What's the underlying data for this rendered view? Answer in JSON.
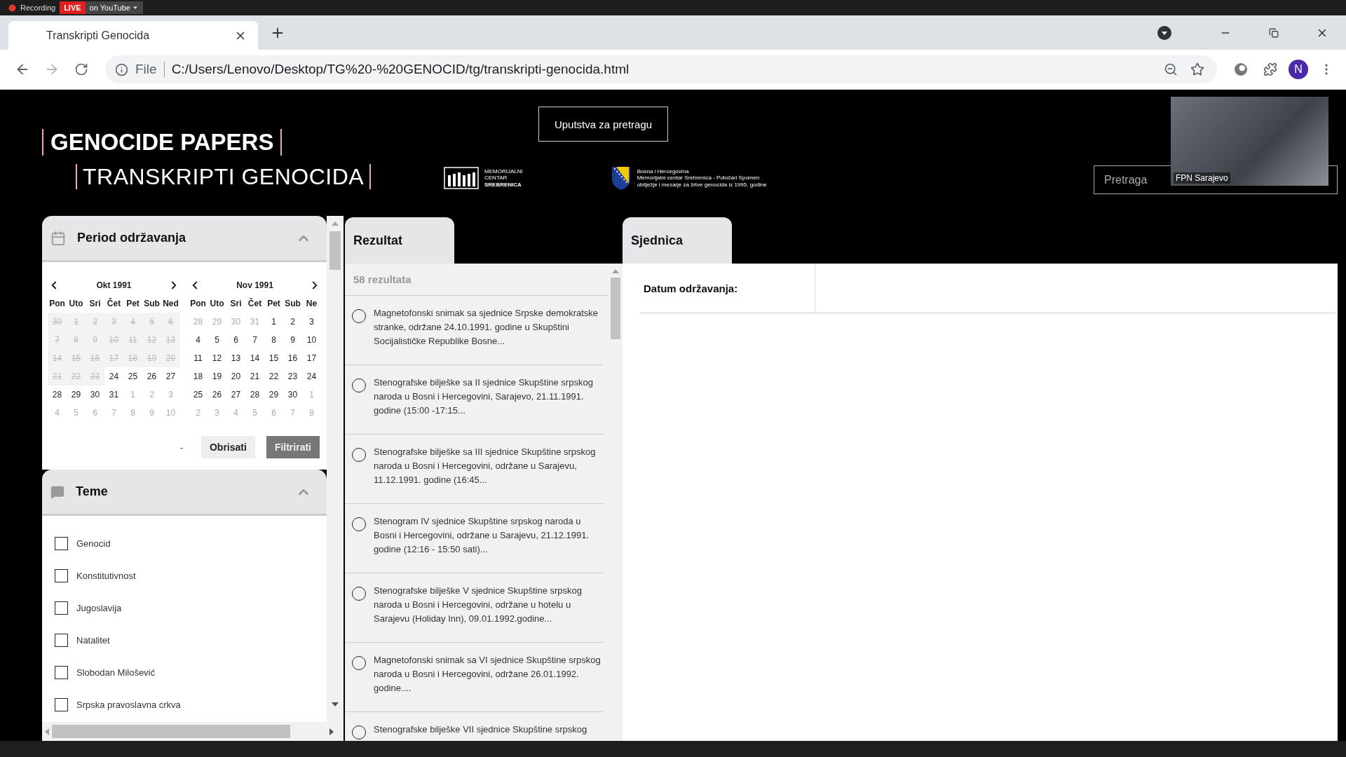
{
  "recording_bar": {
    "status": "Recording",
    "live_badge": "LIVE",
    "platform": "on YouTube"
  },
  "browser": {
    "tab": {
      "title": "Transkripti Genocida",
      "selected": true
    },
    "forward_disabled": true,
    "address": {
      "scheme": "File",
      "url": "C:/Users/Lenovo/Desktop/TG%20-%20GENOCID/tg/transkripti-genocida.html"
    },
    "profile_initial": "N"
  },
  "header": {
    "title": "GENOCIDE PAPERS",
    "subtitle": "TRANSKRIPTI GENOCIDA",
    "help_button": "Uputstva za pretragu",
    "memorial_logo": [
      "MEMORIJALNI",
      "CENTAR",
      "SREBRENICA"
    ],
    "partner_logo": [
      "Bosna i Hercegovina",
      "Memorijalni centar Srebrenica - Potočari Spomen",
      "obilježje i mezarje za žrtve genocida iz 1995. godine"
    ],
    "search": {
      "placeholder": "Pretraga"
    },
    "video": {
      "name": "FPN Sarajevo"
    }
  },
  "filters": {
    "period": {
      "title": "Period održavanja",
      "expanded": true,
      "months": [
        {
          "label": "Okt 1991",
          "weekdays": [
            "Pon",
            "Uto",
            "Sri",
            "Čet",
            "Pet",
            "Sub",
            "Ned"
          ],
          "days": [
            {
              "d": "30",
              "kind": "disabled"
            },
            {
              "d": "1",
              "kind": "disabled"
            },
            {
              "d": "2",
              "kind": "disabled"
            },
            {
              "d": "3",
              "kind": "disabled"
            },
            {
              "d": "4",
              "kind": "disabled"
            },
            {
              "d": "5",
              "kind": "disabled"
            },
            {
              "d": "6",
              "kind": "disabled"
            },
            {
              "d": "7",
              "kind": "disabled"
            },
            {
              "d": "8",
              "kind": "disabled"
            },
            {
              "d": "9",
              "kind": "disabled"
            },
            {
              "d": "10",
              "kind": "disabled"
            },
            {
              "d": "11",
              "kind": "disabled"
            },
            {
              "d": "12",
              "kind": "disabled"
            },
            {
              "d": "13",
              "kind": "disabled"
            },
            {
              "d": "14",
              "kind": "disabled"
            },
            {
              "d": "15",
              "kind": "disabled"
            },
            {
              "d": "16",
              "kind": "disabled"
            },
            {
              "d": "17",
              "kind": "disabled"
            },
            {
              "d": "18",
              "kind": "disabled"
            },
            {
              "d": "19",
              "kind": "disabled"
            },
            {
              "d": "20",
              "kind": "disabled"
            },
            {
              "d": "21",
              "kind": "disabled"
            },
            {
              "d": "22",
              "kind": "disabled"
            },
            {
              "d": "23",
              "kind": "disabled"
            },
            {
              "d": "24",
              "kind": "current"
            },
            {
              "d": "25",
              "kind": "current"
            },
            {
              "d": "26",
              "kind": "current"
            },
            {
              "d": "27",
              "kind": "current"
            },
            {
              "d": "28",
              "kind": "current"
            },
            {
              "d": "29",
              "kind": "current"
            },
            {
              "d": "30",
              "kind": "current"
            },
            {
              "d": "31",
              "kind": "current"
            },
            {
              "d": "1",
              "kind": "other"
            },
            {
              "d": "2",
              "kind": "other"
            },
            {
              "d": "3",
              "kind": "other"
            },
            {
              "d": "4",
              "kind": "other"
            },
            {
              "d": "5",
              "kind": "other"
            },
            {
              "d": "6",
              "kind": "other"
            },
            {
              "d": "7",
              "kind": "other"
            },
            {
              "d": "8",
              "kind": "other"
            },
            {
              "d": "9",
              "kind": "other"
            },
            {
              "d": "10",
              "kind": "other"
            }
          ]
        },
        {
          "label": "Nov 1991",
          "weekdays": [
            "Pon",
            "Uto",
            "Sri",
            "Čet",
            "Pet",
            "Sub",
            "Ne"
          ],
          "days": [
            {
              "d": "28",
              "kind": "other"
            },
            {
              "d": "29",
              "kind": "other"
            },
            {
              "d": "30",
              "kind": "other"
            },
            {
              "d": "31",
              "kind": "other"
            },
            {
              "d": "1",
              "kind": "current"
            },
            {
              "d": "2",
              "kind": "current"
            },
            {
              "d": "3",
              "kind": "current"
            },
            {
              "d": "4",
              "kind": "current"
            },
            {
              "d": "5",
              "kind": "current"
            },
            {
              "d": "6",
              "kind": "current"
            },
            {
              "d": "7",
              "kind": "current"
            },
            {
              "d": "8",
              "kind": "current"
            },
            {
              "d": "9",
              "kind": "current"
            },
            {
              "d": "10",
              "kind": "current"
            },
            {
              "d": "11",
              "kind": "current"
            },
            {
              "d": "12",
              "kind": "current"
            },
            {
              "d": "13",
              "kind": "current"
            },
            {
              "d": "14",
              "kind": "current"
            },
            {
              "d": "15",
              "kind": "current"
            },
            {
              "d": "16",
              "kind": "current"
            },
            {
              "d": "17",
              "kind": "current"
            },
            {
              "d": "18",
              "kind": "current"
            },
            {
              "d": "19",
              "kind": "current"
            },
            {
              "d": "20",
              "kind": "current"
            },
            {
              "d": "21",
              "kind": "current"
            },
            {
              "d": "22",
              "kind": "current"
            },
            {
              "d": "23",
              "kind": "current"
            },
            {
              "d": "24",
              "kind": "current"
            },
            {
              "d": "25",
              "kind": "current"
            },
            {
              "d": "26",
              "kind": "current"
            },
            {
              "d": "27",
              "kind": "current"
            },
            {
              "d": "28",
              "kind": "current"
            },
            {
              "d": "29",
              "kind": "current"
            },
            {
              "d": "30",
              "kind": "current"
            },
            {
              "d": "1",
              "kind": "other"
            },
            {
              "d": "2",
              "kind": "other"
            },
            {
              "d": "3",
              "kind": "other"
            },
            {
              "d": "4",
              "kind": "other"
            },
            {
              "d": "5",
              "kind": "other"
            },
            {
              "d": "6",
              "kind": "other"
            },
            {
              "d": "7",
              "kind": "other"
            },
            {
              "d": "8",
              "kind": "other"
            }
          ]
        }
      ],
      "separator": "-",
      "buttons": [
        "Obrisati",
        "Filtrirati"
      ]
    },
    "topics": {
      "title": "Teme",
      "expanded": true,
      "items": [
        {
          "label": "Genocid",
          "checked": false
        },
        {
          "label": "Konstitutivnost",
          "checked": false
        },
        {
          "label": "Jugoslavija",
          "checked": false
        },
        {
          "label": "Natalitet",
          "checked": false
        },
        {
          "label": "Slobodan Milošević",
          "checked": false
        },
        {
          "label": "Srpska pravoslavna crkva",
          "checked": false
        }
      ]
    }
  },
  "results": {
    "tab": "Rezultat",
    "count": "58 rezultata",
    "items": [
      {
        "text": "Magnetofonski snimak sa sjednice Srpske demokratske stranke, održane 24.10.1991. godine u Skupštini Socijalističke Republike Bosne...",
        "selected": false
      },
      {
        "text": "Stenografske bilješke sa II sjednice Skupštine srpskog naroda u Bosni i Hercegovini, Sarajevo, 21.11.1991. godine (15:00 -17:15...",
        "selected": false
      },
      {
        "text": "Stenografske bilješke sa III sjednice Skupštine srpskog naroda u Bosni i Hercegovini, održane u Sarajevu, 11.12.1991. godine (16:45...",
        "selected": false
      },
      {
        "text": "Stenogram IV sjednice Skupštine srpskog naroda u Bosni i Hercegovini, održane u Sarajevu, 21.12.1991. godine (12:16 - 15:50 sati)...",
        "selected": false
      },
      {
        "text": "Stenografske bilješke V sjednice Skupštine srpskog naroda u Bosni i Hercegovini, održane u hotelu u Sarajevu (Holiday Inn), 09.01.1992.godine...",
        "selected": false
      },
      {
        "text": "Magnetofonski snimak sa VI sjednice Skupštine srpskog naroda u Bosni i Hercegovini, održane 26.01.1992. godine....",
        "selected": false
      },
      {
        "text": "Stenografske bilješke VII sjednice Skupštine srpskog",
        "selected": false
      }
    ]
  },
  "session": {
    "tab": "Sjednica",
    "fields": [
      {
        "label": "Datum održavanja:"
      }
    ]
  }
}
